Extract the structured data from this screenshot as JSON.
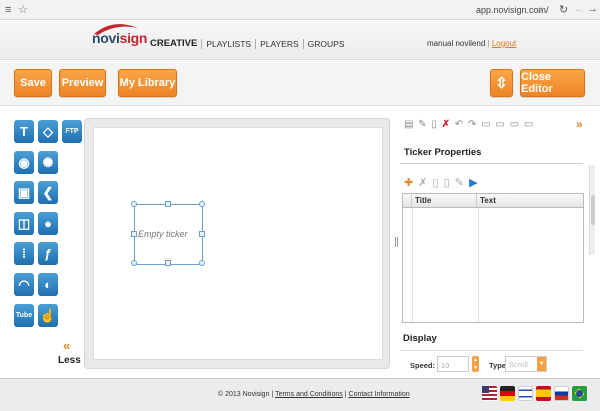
{
  "browser": {
    "menu_icon": "≡",
    "fav_icon": "☆",
    "url": "app.novisign.com/",
    "url_hash": "#",
    "reload_icon": "↻",
    "back_icon": "←",
    "forward_icon": "→"
  },
  "header": {
    "logo_prefix": "novi",
    "logo_suffix": "sign",
    "nav": [
      "CREATIVE",
      "PLAYLISTS",
      "PLAYERS",
      "GROUPS"
    ],
    "user_name": "manual novilend",
    "separator": "|",
    "logout": "Logout"
  },
  "toolbar": {
    "save": "Save",
    "preview": "Preview",
    "library": "My Library",
    "fullscreen_icon": "⇳",
    "close": "Close Editor"
  },
  "widgets": {
    "icons": [
      "T",
      "◇",
      "FTP",
      "◉",
      "✺",
      "▣",
      "❮",
      "◫",
      "●",
      "⁞",
      "ƒ",
      "◠",
      "◐",
      "Tube",
      "☝"
    ],
    "less_arrows": "«",
    "less": "Less"
  },
  "canvas": {
    "placeholder": "Empty ticker"
  },
  "panel": {
    "tools": "▤ ✎ ▯",
    "delete": "✗",
    "tools2": "↶ ↷  ▭ ▭ ▭ ▭",
    "collapse": "»",
    "title": "Ticker Properties",
    "add_icon": "✚",
    "ticker_tools": "✗ ▯ ▯ ✎",
    "play_icon": "▶",
    "columns": [
      "Title",
      "Text"
    ],
    "display": "Display",
    "speed_label": "Speed:",
    "speed_value": "10",
    "type_label": "Type:",
    "type_value": "Scroll"
  },
  "footer": {
    "copyright": "© 2013 Novisign",
    "sep": "|",
    "terms": "Terms and Conditions",
    "contact": "Contact Information",
    "flags": [
      "US",
      "DE",
      "IL",
      "ES",
      "RU",
      "BR"
    ]
  },
  "colors": {
    "accent": "#ec8424",
    "brand_red": "#c4262e",
    "brand_blue": "#2a4a6b",
    "icon_blue": "#1f6fb0"
  }
}
